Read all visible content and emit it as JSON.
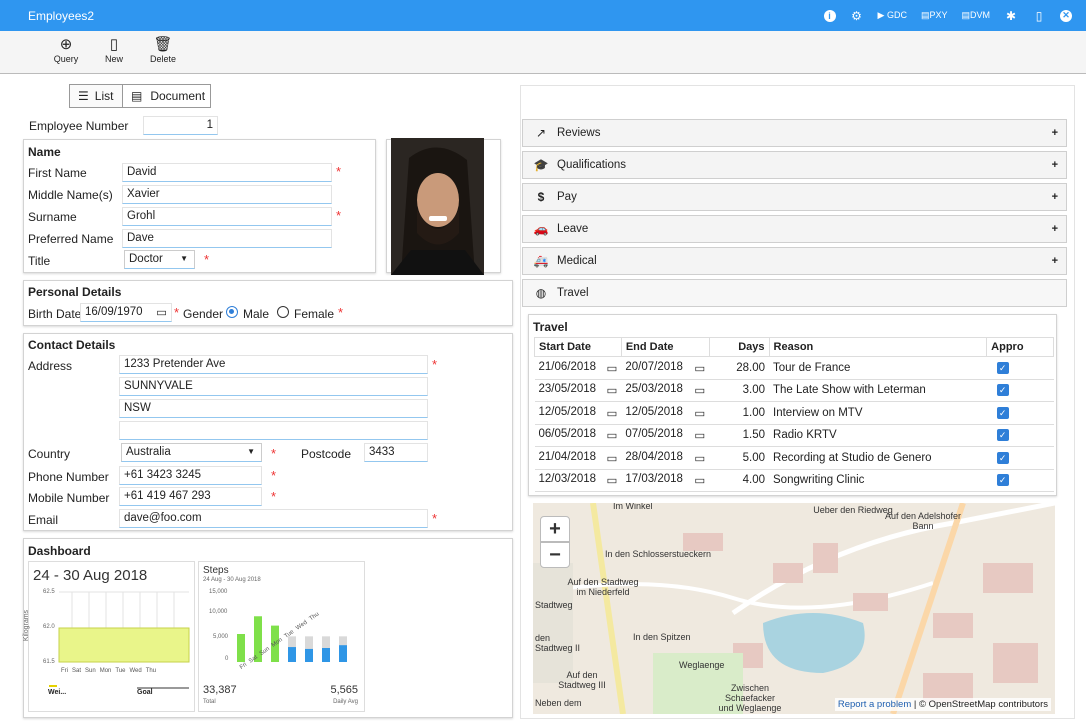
{
  "app": {
    "title": "Employees2"
  },
  "titlebar": {
    "gdc": "GDC",
    "pxy": "PXY",
    "dvm": "DVM"
  },
  "toolbar": {
    "query": "Query",
    "new": "New",
    "delete": "Delete"
  },
  "view_tabs": {
    "list": "List",
    "document": "Document"
  },
  "employee_number": {
    "label": "Employee Number",
    "value": "1"
  },
  "name": {
    "title": "Name",
    "first_label": "First Name",
    "first": "David",
    "middle_label": "Middle Name(s)",
    "middle": "Xavier",
    "surname_label": "Surname",
    "surname": "Grohl",
    "preferred_label": "Preferred Name",
    "preferred": "Dave",
    "title_label": "Title",
    "title_value": "Doctor"
  },
  "personal": {
    "title": "Personal Details",
    "birth_label": "Birth Date",
    "birth": "16/09/1970",
    "gender_label": "Gender",
    "male": "Male",
    "female": "Female"
  },
  "contact": {
    "title": "Contact Details",
    "address_label": "Address",
    "address1": "1233  Pretender Ave",
    "address2": "SUNNYVALE",
    "address3": "NSW",
    "address4": "",
    "country_label": "Country",
    "country": "Australia",
    "postcode_label": "Postcode",
    "postcode": "3433",
    "phone_label": "Phone Number",
    "phone": "+61 3423 3245",
    "mobile_label": "Mobile Number",
    "mobile": "+61 419 467 293",
    "email_label": "Email",
    "email": "dave@foo.com"
  },
  "dashboard": {
    "title": "Dashboard",
    "weight": {
      "range": "24 - 30 Aug 2018",
      "ylabel": "Kilograms",
      "yticks": [
        "62.5",
        "62.0",
        "61.5"
      ],
      "days": [
        "Fri",
        "Sat",
        "Sun",
        "Mon",
        "Tue",
        "Wed",
        "Thu"
      ],
      "legend_weight": "Wei...",
      "legend_goal": "Goal"
    },
    "steps": {
      "title": "Steps",
      "subtitle": "24 Aug - 30 Aug 2018",
      "yticks": [
        "15,000",
        "10,000",
        "5,000",
        "0"
      ],
      "days": [
        "Fri",
        "Sat",
        "Sun",
        "Mon",
        "Tue",
        "Wed",
        "Thu"
      ],
      "total": "33,387",
      "total_label": "Total",
      "avg": "5,565",
      "avg_label": "Daily Avg"
    }
  },
  "chart_data": [
    {
      "type": "bar",
      "title": "Steps",
      "categories": [
        "Fri",
        "Sat",
        "Sun",
        "Mon",
        "Tue",
        "Wed",
        "Thu"
      ],
      "values": [
        6000,
        9800,
        7800,
        3200,
        2800,
        3000,
        3600
      ],
      "goal": [
        0,
        0,
        0,
        5500,
        5500,
        5500,
        5500
      ],
      "ylim": [
        0,
        15000
      ]
    }
  ],
  "accordion": [
    {
      "label": "Reviews",
      "icon": "chart-line-icon"
    },
    {
      "label": "Qualifications",
      "icon": "graduation-cap-icon"
    },
    {
      "label": "Pay",
      "icon": "dollar-icon"
    },
    {
      "label": "Leave",
      "icon": "car-icon"
    },
    {
      "label": "Medical",
      "icon": "ambulance-icon"
    },
    {
      "label": "Travel",
      "icon": "globe-icon"
    }
  ],
  "travel": {
    "title": "Travel",
    "headers": [
      "Start Date",
      "End Date",
      "Days",
      "Reason",
      "Appro"
    ],
    "rows": [
      {
        "start": "21/06/2018",
        "end": "20/07/2018",
        "days": "28.00",
        "reason": "Tour de France"
      },
      {
        "start": "23/05/2018",
        "end": "25/03/2018",
        "days": "3.00",
        "reason": "The Late Show with Leterman"
      },
      {
        "start": "12/05/2018",
        "end": "12/05/2018",
        "days": "1.00",
        "reason": "Interview on MTV"
      },
      {
        "start": "06/05/2018",
        "end": "07/05/2018",
        "days": "1.50",
        "reason": "Radio KRTV"
      },
      {
        "start": "21/04/2018",
        "end": "28/04/2018",
        "days": "5.00",
        "reason": "Recording at Studio de Genero"
      },
      {
        "start": "12/03/2018",
        "end": "17/03/2018",
        "days": "4.00",
        "reason": "Songwriting Clinic"
      }
    ]
  },
  "map": {
    "labels": [
      "Im Winkel",
      "Ueber den Riedweg",
      "Auf den Adelshofer Bann",
      "In den Schlosserstueckern",
      "Auf den Stadtweg im Niederfeld",
      "In den Spitzen",
      "Weglaenge",
      "Zwischen Schaefacker und Weglaenge",
      "Neben dem",
      "Auf den Stadtweg III",
      "den Stadtweg II",
      "Stadtweg"
    ],
    "report": "Report a problem",
    "copyright": "© OpenStreetMap contributors"
  }
}
